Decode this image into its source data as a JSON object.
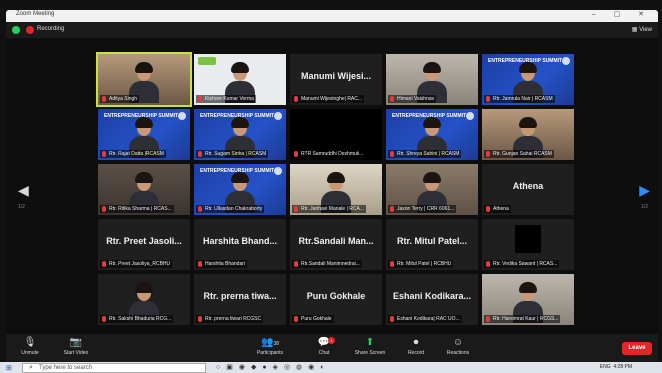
{
  "window": {
    "title": "Zoom Meeting",
    "controls": "–  ▢  ✕"
  },
  "topbar": {
    "recording_label": "Recording",
    "view_label": "View"
  },
  "gallery": {
    "page_left": "1/2",
    "page_right": "1/2",
    "tiles": [
      {
        "type": "video",
        "tag": "Aditya Singh",
        "style": "warm",
        "active": true
      },
      {
        "type": "video",
        "tag": "Kishore Kumar Verma",
        "style": "white"
      },
      {
        "type": "text",
        "display": "Manumi Wijesi...",
        "tag": "Manumi Wijesinghe| RAC...",
        "style": "dark"
      },
      {
        "type": "video",
        "tag": "Himani Vaishnav",
        "style": "lightroom"
      },
      {
        "type": "video",
        "tag": "Rtr. Jamrula Nair | RCASM",
        "style": "blue",
        "banner": "ENTREPRENEURSHIP SUMMIT"
      },
      {
        "type": "video",
        "tag": "Rtr. Rajat Datta |RCASM",
        "style": "blue",
        "banner": "ENTREPRENEURSHIP SUMMIT"
      },
      {
        "type": "video",
        "tag": "Rtr. Sugam Sinha | RCASM",
        "style": "blue",
        "banner": "ENTREPRENEURSHIP SUMMIT"
      },
      {
        "type": "black",
        "tag": "RTR Samruddhi Deshmuk...",
        "style": "black"
      },
      {
        "type": "video",
        "tag": "Rtr. Shreya Sahini | RCASM",
        "style": "blue",
        "banner": "ENTREPRENEURSHIP SUMMIT"
      },
      {
        "type": "video",
        "tag": "Rtr. Gunjan Sahai RCASM",
        "style": "warm"
      },
      {
        "type": "video",
        "tag": "Rtr. Ritika Sharma | RCAS...",
        "style": "indoor"
      },
      {
        "type": "video",
        "tag": "Rtr. Ullasdan Chakraborty",
        "style": "blue",
        "banner": "ENTREPRENEURSHIP SUMMIT"
      },
      {
        "type": "video",
        "tag": "Rtr. Janhavi Manale | RCA...",
        "style": "yellowbg"
      },
      {
        "type": "video",
        "tag": "Jason Terry | CRR 6061...",
        "style": "room"
      },
      {
        "type": "text",
        "display": "Athena",
        "tag": "Athena",
        "style": "dark"
      },
      {
        "type": "text",
        "display": "Rtr. Preet Jasoli...",
        "tag": "Rtr. Preet Jasoliya_RCBHU",
        "style": "dark"
      },
      {
        "type": "text",
        "display": "Harshita Bhand...",
        "tag": "Harshita Bhandari",
        "style": "dark"
      },
      {
        "type": "text",
        "display": "Rtr.Sandali Man...",
        "tag": "Rtr.Sandali Manimnedrai...",
        "style": "dark"
      },
      {
        "type": "text",
        "display": "Rtr. Mitul Patel...",
        "tag": "Rtr. Mitul Patel | RCBHU",
        "style": "dark"
      },
      {
        "type": "blackbox",
        "tag": "Rtr. Vedika Sawant | RCAS...",
        "style": "dark"
      },
      {
        "type": "video",
        "tag": "Rtr. Sakshi Bhaduria RCG...",
        "style": "dark"
      },
      {
        "type": "text",
        "display": "Rtr. prerna tiwa...",
        "tag": "Rtr. prerna tiwari RCGSC",
        "style": "dark"
      },
      {
        "type": "text",
        "display": "Puru Gokhale",
        "tag": "Puru Gokhale",
        "style": "dark"
      },
      {
        "type": "text",
        "display": "Eshani Kodikara...",
        "tag": "Eshani Kodikara| RAC UO...",
        "style": "dark"
      },
      {
        "type": "video",
        "tag": "Rtr. Harsimrat Kaur | RCGS...",
        "style": "lightroom"
      }
    ]
  },
  "toolbar": {
    "unmute": "Unmute",
    "start_video": "Start Video",
    "participants": "Participants",
    "participants_count": "38",
    "chat": "Chat",
    "chat_badge": "1",
    "share": "Share Screen",
    "record": "Record",
    "reactions": "Reactions",
    "leave": "Leave"
  },
  "taskbar": {
    "search_placeholder": "Type here to search",
    "lang": "ENG",
    "time": "4:28 PM"
  }
}
